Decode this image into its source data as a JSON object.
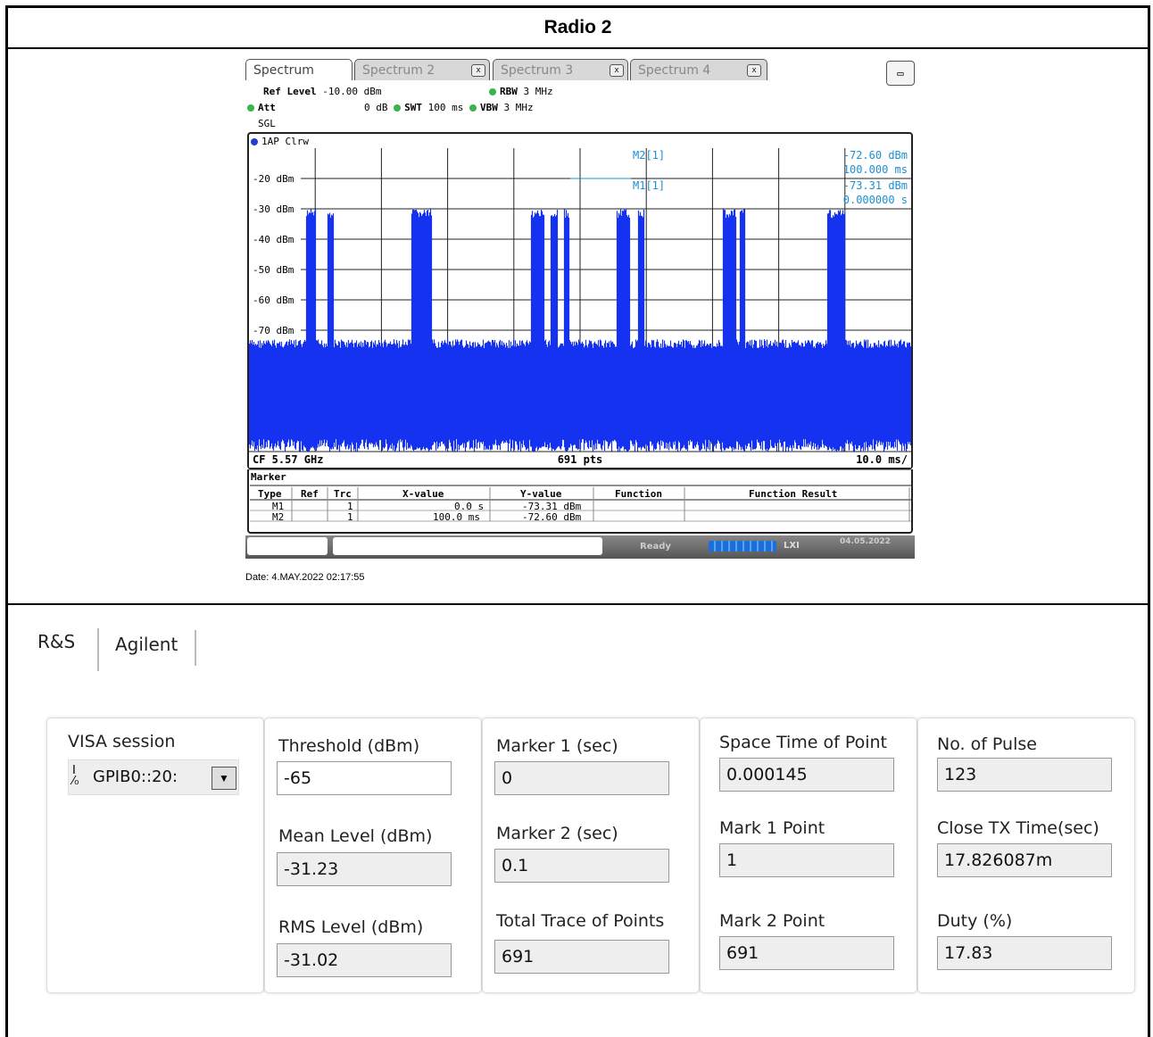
{
  "title": "Radio 2",
  "analyzer": {
    "tabs": [
      "Spectrum",
      "Spectrum 2",
      "Spectrum 3",
      "Spectrum 4"
    ],
    "tab_close": "x",
    "ref_level_label": "Ref Level",
    "ref_level": "-10.00 dBm",
    "att_label": "Att",
    "att": "0 dB",
    "swt_label": "SWT",
    "swt": "100 ms",
    "rbw_label": "RBW",
    "rbw": "3 MHz",
    "vbw_label": "VBW",
    "vbw": "3 MHz",
    "sgl": "SGL",
    "trace_label": "1AP Clrw",
    "y_ticks": [
      "-20 dBm",
      "-30 dBm",
      "-40 dBm",
      "-50 dBm",
      "-60 dBm",
      "-70 dBm"
    ],
    "m2_label": "M2[1]",
    "m2_value": "-72.60 dBm",
    "m2_time": "100.000 ms",
    "m1_label": "M1[1]",
    "m1_value": "-73.31 dBm",
    "m1_time": "0.000000 s",
    "cf": "CF 5.57 GHz",
    "pts": "691 pts",
    "span": "10.0 ms/",
    "marker_title": "Marker",
    "marker_headers": [
      "Type",
      "Ref",
      "Trc",
      "X-value",
      "Y-value",
      "Function",
      "Function Result"
    ],
    "marker_rows": [
      {
        "type": "M1",
        "ref": "",
        "trc": "1",
        "x": "0.0 s",
        "y": "-73.31 dBm",
        "fn": "",
        "res": ""
      },
      {
        "type": "M2",
        "ref": "",
        "trc": "1",
        "x": "100.0 ms",
        "y": "-72.60 dBm",
        "fn": "",
        "res": ""
      }
    ],
    "status_ready": "Ready",
    "status_date": "04.05.2022",
    "status_lxi": "LXI",
    "threshold_line_dbm": -65,
    "bursts": [
      {
        "start": 0.085,
        "end": 0.1
      },
      {
        "start": 0.118,
        "end": 0.128
      },
      {
        "start": 0.245,
        "end": 0.275
      },
      {
        "start": 0.425,
        "end": 0.445
      },
      {
        "start": 0.455,
        "end": 0.465
      },
      {
        "start": 0.475,
        "end": 0.483
      },
      {
        "start": 0.555,
        "end": 0.575
      },
      {
        "start": 0.587,
        "end": 0.597
      },
      {
        "start": 0.715,
        "end": 0.735
      },
      {
        "start": 0.74,
        "end": 0.748
      },
      {
        "start": 0.873,
        "end": 0.9
      }
    ]
  },
  "date_line": "Date: 4.MAY.2022  02:17:55",
  "panel": {
    "tabs": [
      "R&S",
      "Agilent"
    ],
    "visa_label": "VISA session",
    "visa_value": "GPIB0::20:",
    "threshold_label": "Threshold (dBm)",
    "threshold_value": "-65",
    "mean_label": "Mean Level (dBm)",
    "mean_value": "-31.23",
    "rms_label": "RMS Level (dBm)",
    "rms_value": "-31.02",
    "marker1_label": "Marker 1 (sec)",
    "marker1_value": "0",
    "marker2_label": "Marker 2 (sec)",
    "marker2_value": "0.1",
    "total_label": "Total Trace of Points",
    "total_value": "691",
    "space_label": "Space Time of Point",
    "space_value": "0.000145",
    "mark1pt_label": "Mark 1 Point",
    "mark1pt_value": "1",
    "mark2pt_label": "Mark 2 Point",
    "mark2pt_value": "691",
    "pulse_label": "No. of Pulse",
    "pulse_value": "123",
    "close_label": "Close TX Time(sec)",
    "close_value": "17.826087m",
    "duty_label": "Duty (%)",
    "duty_value": "17.83"
  }
}
